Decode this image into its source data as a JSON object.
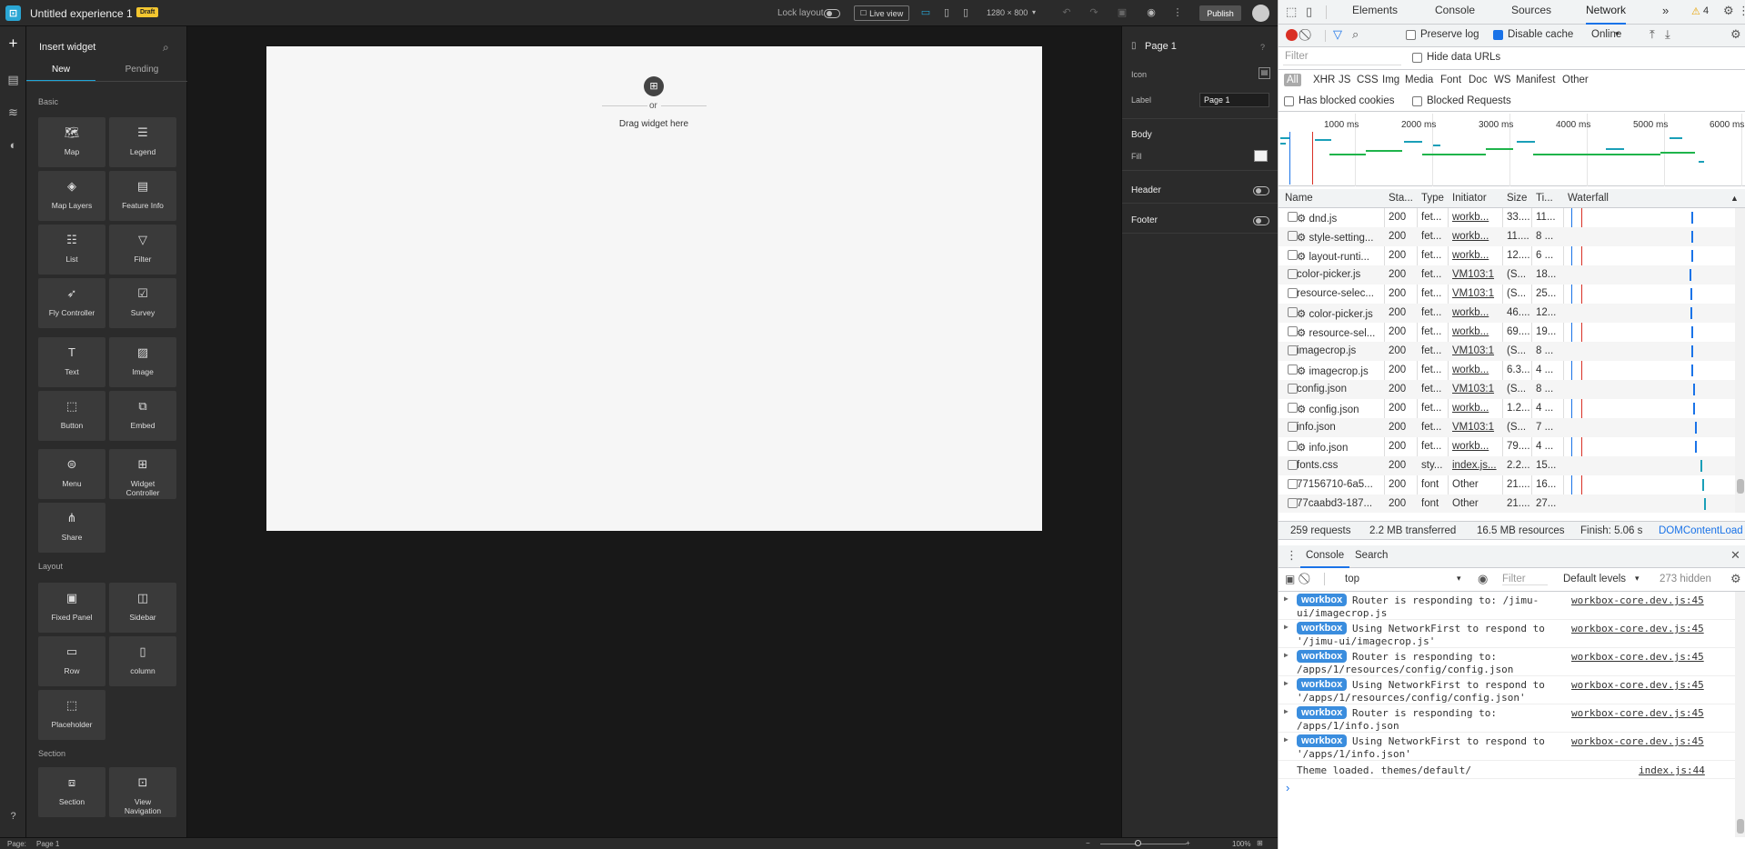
{
  "builder": {
    "app_title": "Untitled experience 1",
    "draft_badge": "Draft",
    "lock_layout": "Lock layout",
    "live_view": "Live view",
    "resolution": "1280 × 800",
    "publish": "Publish",
    "insert_title": "Insert widget",
    "tabs": {
      "new": "New",
      "pending": "Pending"
    },
    "sections": {
      "basic": "Basic",
      "layout": "Layout",
      "section": "Section"
    },
    "widgets": {
      "map": "Map",
      "legend": "Legend",
      "map_layers": "Map Layers",
      "feature_info": "Feature Info",
      "list": "List",
      "filter": "Filter",
      "fly_controller": "Fly Controller",
      "survey": "Survey",
      "text": "Text",
      "image": "Image",
      "button": "Button",
      "embed": "Embed",
      "menu": "Menu",
      "widget_controller": "Widget Controller",
      "share": "Share",
      "fixed_panel": "Fixed Panel",
      "sidebar": "Sidebar",
      "row": "Row",
      "column": "column",
      "placeholder": "Placeholder",
      "section": "Section",
      "view_navigation": "View Navigation"
    },
    "canvas": {
      "or": "or",
      "drag_text": "Drag widget here"
    },
    "props": {
      "page_title": "Page 1",
      "icon_label": "Icon",
      "label_label": "Label",
      "label_value": "Page 1",
      "body": "Body",
      "fill": "Fill",
      "header": "Header",
      "footer": "Footer"
    },
    "status": {
      "page_label": "Page:",
      "page_value": "Page 1",
      "zoom": "100%"
    }
  },
  "devtools": {
    "tabs": [
      "Elements",
      "Console",
      "Sources",
      "Network"
    ],
    "more": "»",
    "warnings": "4",
    "toolbar": {
      "preserve_log": "Preserve log",
      "disable_cache": "Disable cache",
      "throttle": "Online"
    },
    "filter_placeholder": "Filter",
    "hide_data_urls": "Hide data URLs",
    "types": [
      "All",
      "XHR",
      "JS",
      "CSS",
      "Img",
      "Media",
      "Font",
      "Doc",
      "WS",
      "Manifest",
      "Other"
    ],
    "has_blocked_cookies": "Has blocked cookies",
    "blocked_requests": "Blocked Requests",
    "timeline_marks": [
      "1000 ms",
      "2000 ms",
      "3000 ms",
      "4000 ms",
      "5000 ms",
      "6000 ms"
    ],
    "columns": {
      "name": "Name",
      "status": "Sta...",
      "type": "Type",
      "initiator": "Initiator",
      "size": "Size",
      "time": "Ti...",
      "waterfall": "Waterfall"
    },
    "rows": [
      {
        "name": "⚙ dnd.js",
        "status": "200",
        "type": "fet...",
        "initiator": "workb...",
        "size": "33....",
        "time": "11..."
      },
      {
        "name": "⚙ style-setting...",
        "status": "200",
        "type": "fet...",
        "initiator": "workb...",
        "size": "11....",
        "time": "8 ..."
      },
      {
        "name": "⚙ layout-runti...",
        "status": "200",
        "type": "fet...",
        "initiator": "workb...",
        "size": "12....",
        "time": "6 ..."
      },
      {
        "name": "color-picker.js",
        "status": "200",
        "type": "fet...",
        "initiator": "VM103:1",
        "size": "(S...",
        "time": "18..."
      },
      {
        "name": "resource-selec...",
        "status": "200",
        "type": "fet...",
        "initiator": "VM103:1",
        "size": "(S...",
        "time": "25..."
      },
      {
        "name": "⚙ color-picker.js",
        "status": "200",
        "type": "fet...",
        "initiator": "workb...",
        "size": "46....",
        "time": "12..."
      },
      {
        "name": "⚙ resource-sel...",
        "status": "200",
        "type": "fet...",
        "initiator": "workb...",
        "size": "69....",
        "time": "19..."
      },
      {
        "name": "imagecrop.js",
        "status": "200",
        "type": "fet...",
        "initiator": "VM103:1",
        "size": "(S...",
        "time": "8 ..."
      },
      {
        "name": "⚙ imagecrop.js",
        "status": "200",
        "type": "fet...",
        "initiator": "workb...",
        "size": "6.3...",
        "time": "4 ..."
      },
      {
        "name": "config.json",
        "status": "200",
        "type": "fet...",
        "initiator": "VM103:1",
        "size": "(S...",
        "time": "8 ..."
      },
      {
        "name": "⚙ config.json",
        "status": "200",
        "type": "fet...",
        "initiator": "workb...",
        "size": "1.2...",
        "time": "4 ..."
      },
      {
        "name": "info.json",
        "status": "200",
        "type": "fet...",
        "initiator": "VM103:1",
        "size": "(S...",
        "time": "7 ..."
      },
      {
        "name": "⚙ info.json",
        "status": "200",
        "type": "fet...",
        "initiator": "workb...",
        "size": "79....",
        "time": "4 ..."
      },
      {
        "name": "fonts.css",
        "status": "200",
        "type": "sty...",
        "initiator": "index.js...",
        "size": "2.2...",
        "time": "15..."
      },
      {
        "name": "77156710-6a5...",
        "status": "200",
        "type": "font",
        "initiator": "Other",
        "size": "21....",
        "time": "16..."
      },
      {
        "name": "77caabd3-187...",
        "status": "200",
        "type": "font",
        "initiator": "Other",
        "size": "21....",
        "time": "27..."
      }
    ],
    "summary": {
      "requests": "259 requests",
      "transferred": "2.2 MB transferred",
      "resources": "16.5 MB resources",
      "finish": "Finish: 5.06 s",
      "dom": "DOMContentLoad"
    },
    "drawer_tabs": [
      "Console",
      "Search"
    ],
    "console": {
      "context": "top",
      "filter_placeholder": "Filter",
      "levels": "Default levels",
      "hidden": "273 hidden",
      "logs": [
        {
          "badge": "workbox",
          "msg": "Router is responding to: /jimu-\nui/imagecrop.js",
          "src": "workbox-core.dev.js:45"
        },
        {
          "badge": "workbox",
          "msg": "Using NetworkFirst to respond to\n'/jimu-ui/imagecrop.js'",
          "src": "workbox-core.dev.js:45"
        },
        {
          "badge": "workbox",
          "msg": "Router is responding to:\n/apps/1/resources/config/config.json",
          "src": "workbox-core.dev.js:45"
        },
        {
          "badge": "workbox",
          "msg": "Using NetworkFirst to respond to\n'/apps/1/resources/config/config.json'",
          "src": "workbox-core.dev.js:45"
        },
        {
          "badge": "workbox",
          "msg": "Router is responding to:\n/apps/1/info.json",
          "src": "workbox-core.dev.js:45"
        },
        {
          "badge": "workbox",
          "msg": "Using NetworkFirst to respond to\n'/apps/1/info.json'",
          "src": "workbox-core.dev.js:45"
        }
      ],
      "plain_log": {
        "msg": "Theme loaded. themes/default/",
        "src": "index.js:44"
      },
      "prompt": "›"
    }
  }
}
